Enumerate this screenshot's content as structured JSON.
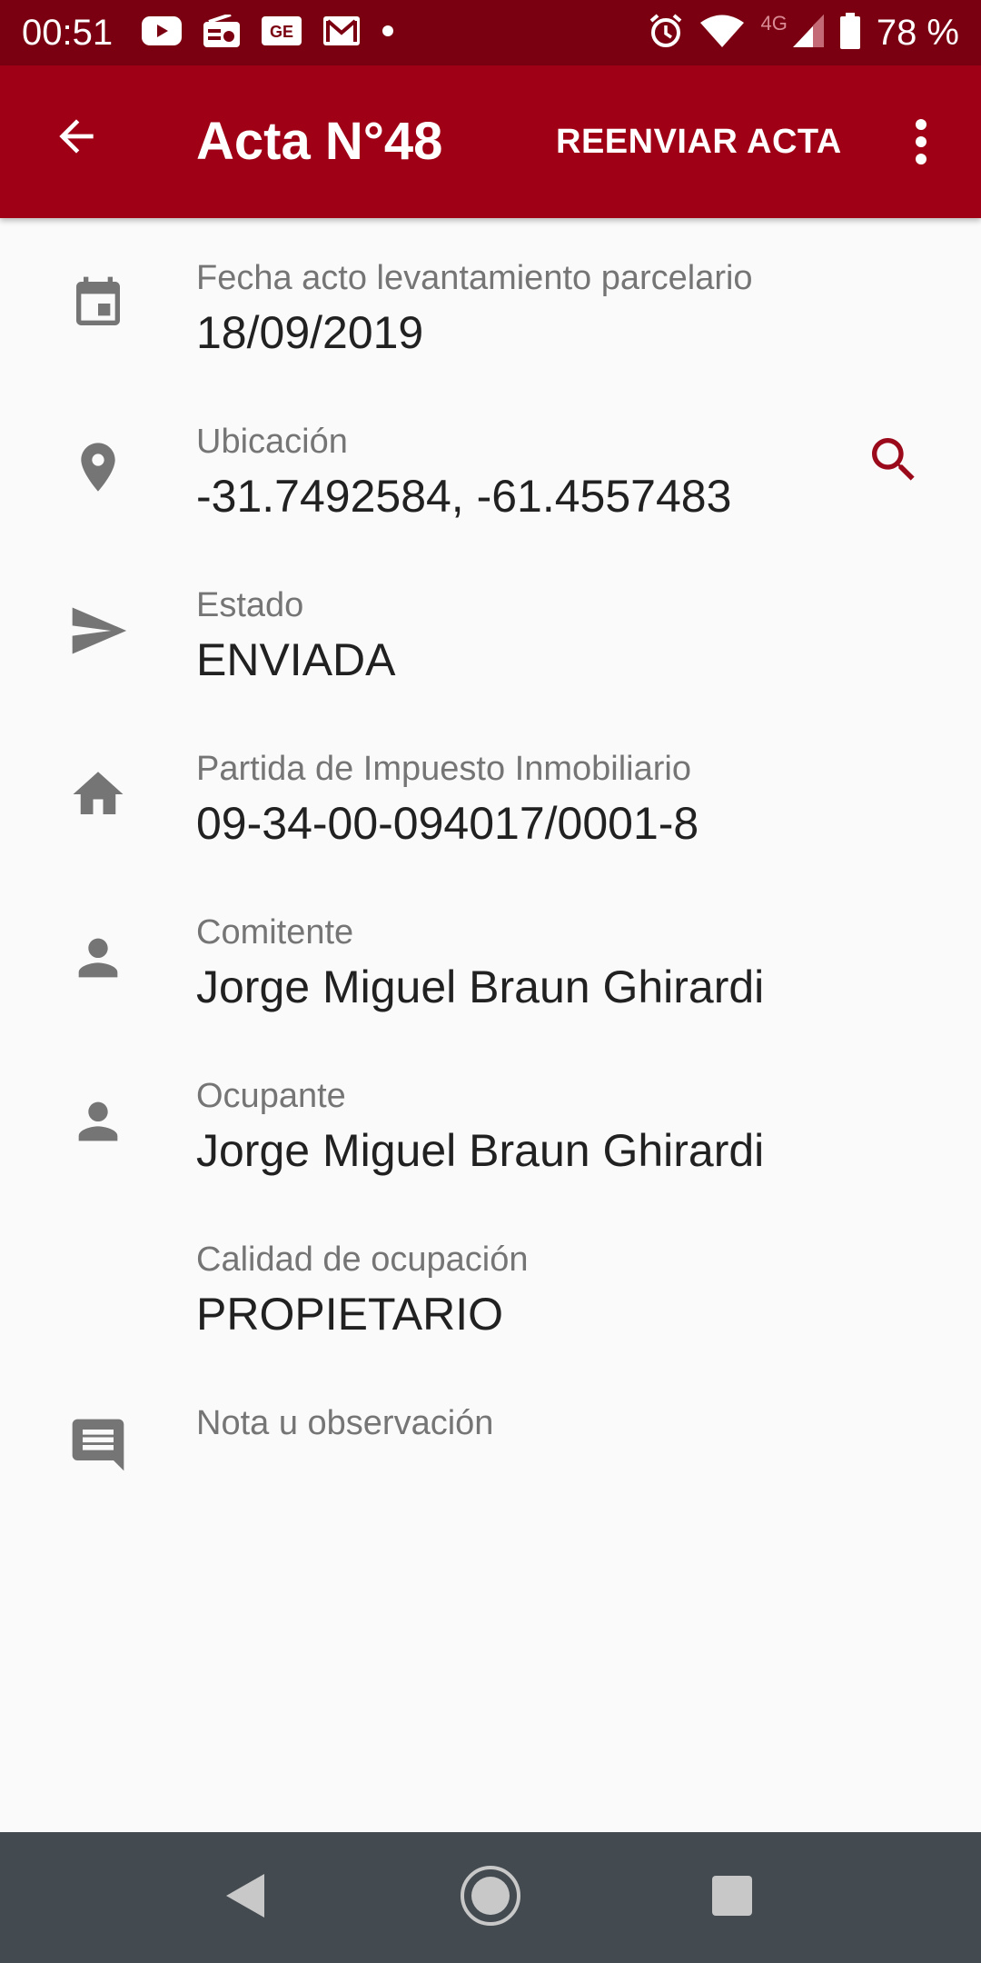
{
  "status_bar": {
    "time": "00:51",
    "network_label": "4G",
    "battery_percent": "78 %",
    "icons": [
      "youtube-icon",
      "radio-icon",
      "ge-icon",
      "gmail-icon",
      "dot-icon",
      "alarm-icon",
      "wifi-icon",
      "signal-icon",
      "battery-icon"
    ]
  },
  "app_bar": {
    "title": "Acta N°48",
    "action_label": "REENVIAR ACTA",
    "back_icon": "arrow-back-icon",
    "overflow_icon": "more-vert-icon"
  },
  "fields": [
    {
      "label": "Fecha acto levantamiento parcelario",
      "value": "18/09/2019",
      "icon": "calendar-icon"
    },
    {
      "label": "Ubicación",
      "value": "-31.7492584, -61.4557483",
      "icon": "location-pin-icon"
    },
    {
      "label": "Estado",
      "value": "ENVIADA",
      "icon": "send-icon"
    },
    {
      "label": "Partida de Impuesto Inmobiliario",
      "value": "09-34-00-094017/0001-8",
      "icon": "home-icon"
    },
    {
      "label": "Comitente",
      "value": "Jorge Miguel Braun Ghirardi",
      "icon": "person-icon"
    },
    {
      "label": "Ocupante",
      "value": "Jorge Miguel Braun Ghirardi",
      "icon": "person-icon"
    },
    {
      "label": "Calidad de ocupación",
      "value": "PROPIETARIO",
      "icon": ""
    },
    {
      "label": "Nota u observación",
      "value": "",
      "icon": "comment-icon"
    }
  ],
  "colors": {
    "status_bar": "#7a0011",
    "app_bar": "#a00016",
    "accent": "#9b0a1b",
    "icon_gray": "#757575",
    "label_gray": "#757575",
    "value_text": "#212121",
    "background": "#fafafa",
    "nav_bar": "#434a50"
  }
}
